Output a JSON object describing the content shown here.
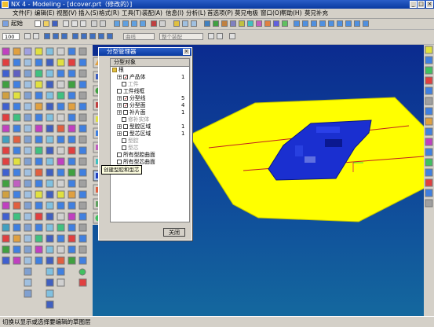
{
  "window": {
    "title": "NX 4 - Modeling - [dcover.prt（修改的）]"
  },
  "menu": [
    "文件(F)",
    "编辑(E)",
    "视图(V)",
    "插入(S)",
    "格式(R)",
    "工具(T)",
    "装配(A)",
    "信息(I)",
    "分析(L)",
    "首选项(P)",
    "莫兄电极",
    "窗口(O)",
    "帮助(H)",
    "莫兄补充"
  ],
  "toolbar1": {
    "start_label": "起始"
  },
  "toolbar2": {
    "zoom_value": "100",
    "filter_combo": "曲线",
    "assembly_combo": "整个装配"
  },
  "dialog": {
    "title": "分型管理器",
    "tree_header": "分型对象",
    "nodes": [
      {
        "label": "根",
        "level": 0,
        "expander": "",
        "checked": null,
        "count": ""
      },
      {
        "label": "产品体",
        "level": 1,
        "expander": "+",
        "checked": true,
        "count": "1"
      },
      {
        "label": "工件",
        "level": 2,
        "expander": "",
        "checked": false,
        "count": ""
      },
      {
        "label": "工件线框",
        "level": 1,
        "expander": "",
        "checked": false,
        "count": ""
      },
      {
        "label": "分型线",
        "level": 1,
        "expander": "+",
        "checked": true,
        "count": "5"
      },
      {
        "label": "分型面",
        "level": 1,
        "expander": "+",
        "checked": true,
        "count": "4"
      },
      {
        "label": "补片面",
        "level": 1,
        "expander": "+",
        "checked": false,
        "count": "1"
      },
      {
        "label": "修补实体",
        "level": 2,
        "expander": "",
        "checked": false,
        "count": ""
      },
      {
        "label": "型腔区域",
        "level": 1,
        "expander": "+",
        "checked": false,
        "count": "1"
      },
      {
        "label": "型芯区域",
        "level": 1,
        "expander": "+",
        "checked": false,
        "count": "1"
      },
      {
        "label": "型腔",
        "level": 2,
        "expander": "",
        "checked": false,
        "count": ""
      },
      {
        "label": "型芯",
        "level": 2,
        "expander": "",
        "checked": false,
        "count": ""
      },
      {
        "label": "所有型腔曲面",
        "level": 1,
        "expander": "",
        "checked": false,
        "count": ""
      },
      {
        "label": "所有型芯曲面",
        "level": 1,
        "expander": "",
        "checked": false,
        "count": ""
      }
    ],
    "close_label": "关闭"
  },
  "tooltip": "创建型腔和型芯",
  "status": "切换以显示或选择要编辑的草图层"
}
